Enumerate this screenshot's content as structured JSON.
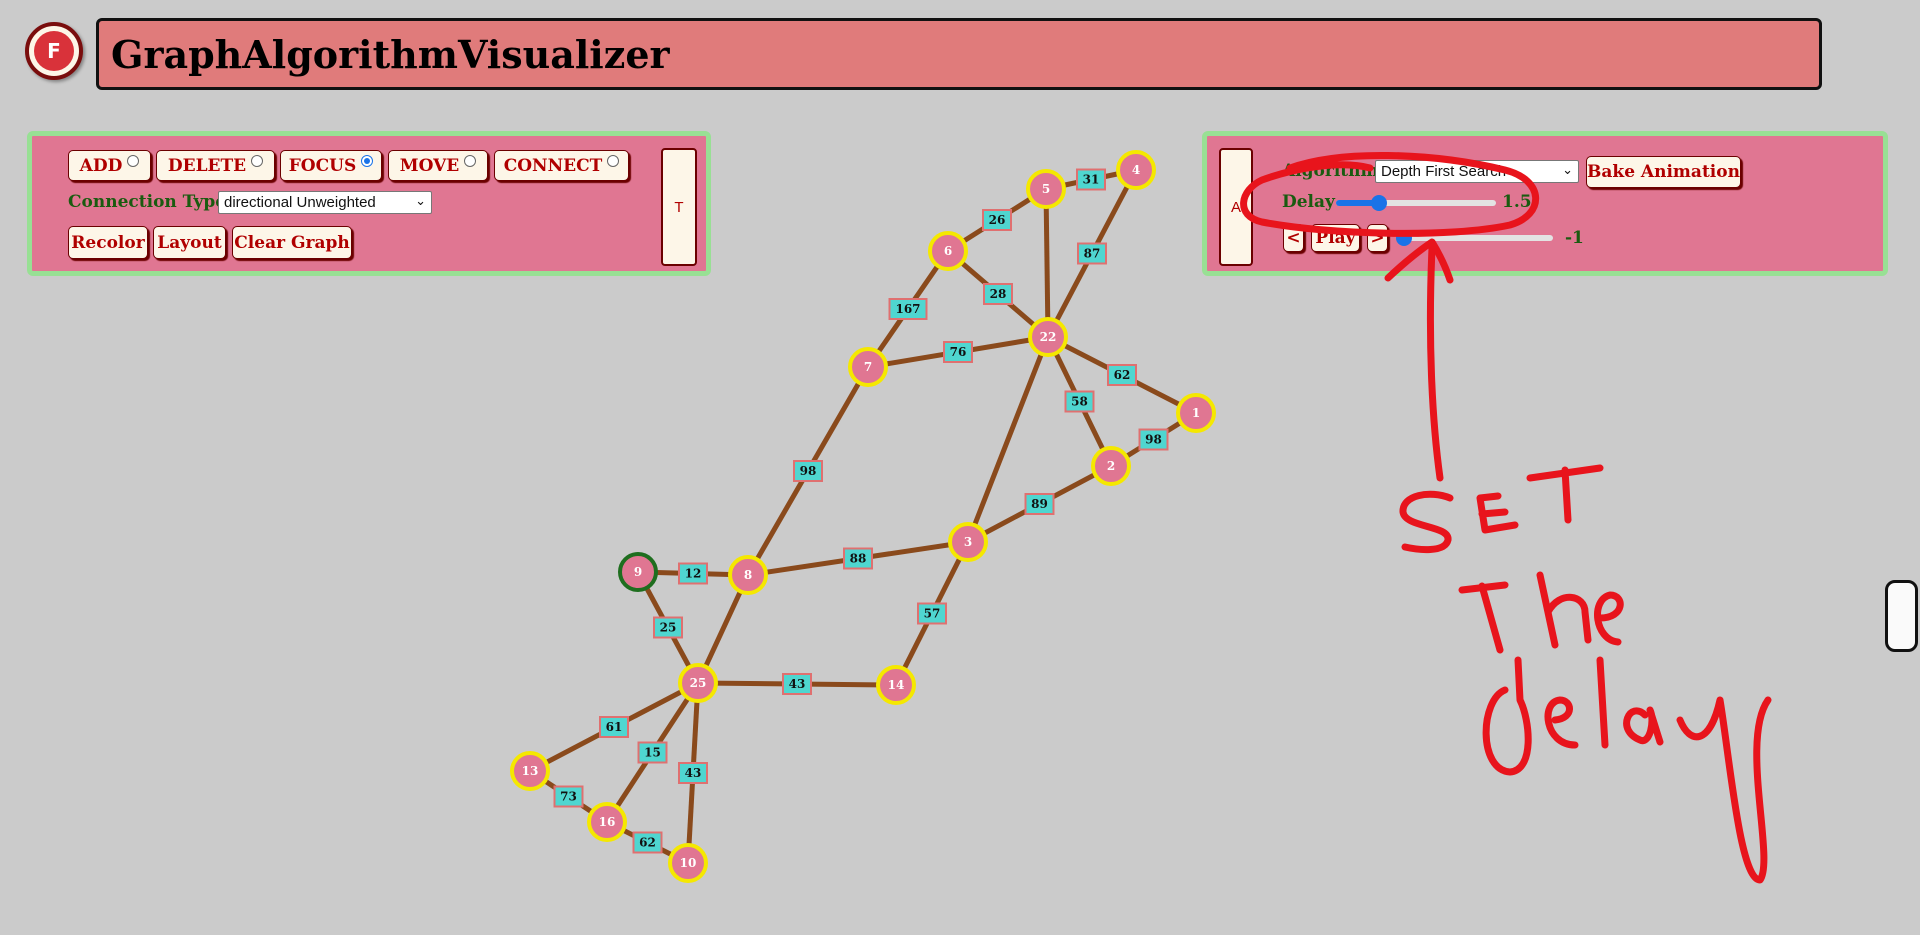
{
  "app": {
    "logo_letter": "F",
    "title": "GraphAlgorithmVisualizer"
  },
  "left_panel": {
    "modes": [
      {
        "label": "ADD",
        "selected": false
      },
      {
        "label": "DELETE",
        "selected": false
      },
      {
        "label": "FOCUS",
        "selected": true
      },
      {
        "label": "MOVE",
        "selected": false
      },
      {
        "label": "CONNECT",
        "selected": false
      }
    ],
    "connection_type_label": "Connection Type",
    "connection_type_value": "directional Unweighted",
    "recolor_label": "Recolor",
    "layout_label": "Layout",
    "clear_label": "Clear Graph",
    "side_tab_label": "T"
  },
  "right_panel": {
    "side_tab_label": "A",
    "algorithm_label": "Algorithm",
    "algorithm_value": "Depth First Search",
    "bake_label": "Bake Animation",
    "delay_label": "Delay",
    "delay_value": "1.5",
    "delay_fraction": 0.27,
    "prev_label": "<",
    "play_label": "Play",
    "next_label": ">",
    "step_value": "-1",
    "step_fraction": 0.0
  },
  "annotation": {
    "text_line1": "SET",
    "text_line2": "The",
    "text_line3": "delay",
    "color": "#e8141c"
  },
  "graph": {
    "colors": {
      "node_fill": "#e07692",
      "node_border": "#f5e800",
      "selected_border": "#1f6e1f",
      "edge": "#8a4a1c",
      "weight_fill": "#4fd6d0",
      "weight_border": "#e07070"
    },
    "nodes": [
      {
        "id": "4",
        "label": "4"
      },
      {
        "id": "5",
        "label": "5"
      },
      {
        "id": "6",
        "label": "6"
      },
      {
        "id": "22",
        "label": "22"
      },
      {
        "id": "7",
        "label": "7"
      },
      {
        "id": "1",
        "label": "1"
      },
      {
        "id": "2",
        "label": "2"
      },
      {
        "id": "3",
        "label": "3"
      },
      {
        "id": "9",
        "label": "9",
        "selected": true
      },
      {
        "id": "8",
        "label": "8"
      },
      {
        "id": "25",
        "label": "25"
      },
      {
        "id": "14",
        "label": "14"
      },
      {
        "id": "13",
        "label": "13"
      },
      {
        "id": "16",
        "label": "16"
      },
      {
        "id": "10",
        "label": "10"
      }
    ],
    "edges": [
      {
        "from": "5",
        "to": "4",
        "weight": "31"
      },
      {
        "from": "4",
        "to": "22",
        "weight": "87"
      },
      {
        "from": "6",
        "to": "5",
        "weight": "26"
      },
      {
        "from": "5",
        "to": "22",
        "weight": ""
      },
      {
        "from": "6",
        "to": "22",
        "weight": "28"
      },
      {
        "from": "7",
        "to": "6",
        "weight": "167"
      },
      {
        "from": "7",
        "to": "22",
        "weight": "76"
      },
      {
        "from": "22",
        "to": "1",
        "weight": "62"
      },
      {
        "from": "22",
        "to": "2",
        "weight": "58"
      },
      {
        "from": "2",
        "to": "1",
        "weight": "98"
      },
      {
        "from": "22",
        "to": "3",
        "weight": ""
      },
      {
        "from": "3",
        "to": "2",
        "weight": "89"
      },
      {
        "from": "8",
        "to": "7",
        "weight": "98"
      },
      {
        "from": "8",
        "to": "3",
        "weight": "88"
      },
      {
        "from": "9",
        "to": "8",
        "weight": "12"
      },
      {
        "from": "9",
        "to": "25",
        "weight": "25"
      },
      {
        "from": "25",
        "to": "8",
        "weight": ""
      },
      {
        "from": "3",
        "to": "14",
        "weight": "57"
      },
      {
        "from": "25",
        "to": "14",
        "weight": "43"
      },
      {
        "from": "25",
        "to": "13",
        "weight": "61"
      },
      {
        "from": "25",
        "to": "16",
        "weight": "15"
      },
      {
        "from": "25",
        "to": "10",
        "weight": "43"
      },
      {
        "from": "13",
        "to": "16",
        "weight": "73"
      },
      {
        "from": "16",
        "to": "10",
        "weight": "62"
      }
    ]
  }
}
